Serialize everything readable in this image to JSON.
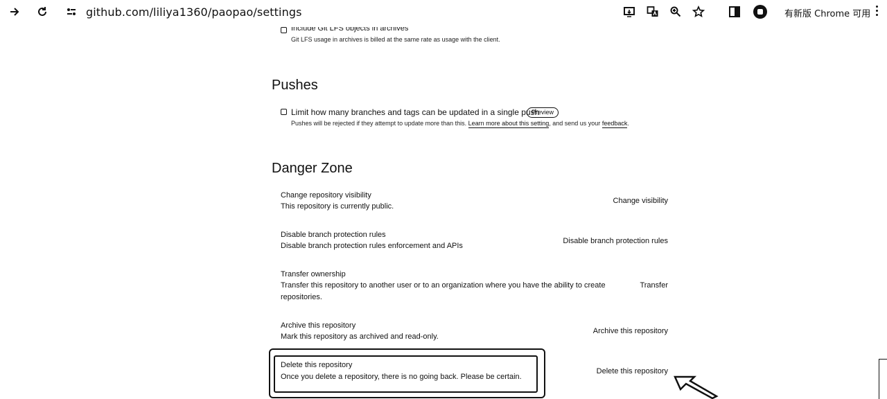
{
  "browser": {
    "url": "github.com/liliya1360/paopao/settings",
    "update_label": "有新版 Chrome 可用",
    "icons": [
      "forward-icon",
      "reload-icon",
      "site-settings-icon",
      "install-app-icon",
      "translate-icon",
      "zoom-icon",
      "bookmark-star-icon",
      "side-panel-icon",
      "extension-icon",
      "more-menu-icon"
    ]
  },
  "archives": {
    "lfs_label": "Include Git LFS objects in archives",
    "lfs_note": "Git LFS usage in archives is billed at the same rate as usage with the client."
  },
  "pushes": {
    "heading": "Pushes",
    "limit_label": "Limit how many branches and tags can be updated in a single push",
    "preview_badge": "Preview",
    "note_prefix": "Pushes will be rejected if they attempt to update more than this.",
    "learn_more_link": "Learn more about this setting",
    "note_middle": ", and send us your",
    "feedback_link": "feedback",
    "note_suffix": "."
  },
  "danger_zone": {
    "heading": "Danger Zone",
    "items": [
      {
        "title": "Change repository visibility",
        "description": "This repository is currently public.",
        "action": "Change visibility"
      },
      {
        "title": "Disable branch protection rules",
        "description": "Disable branch protection rules enforcement and APIs",
        "action": "Disable branch protection rules"
      },
      {
        "title": "Transfer ownership",
        "description_line1": "Transfer this repository to another user or to an organization where you have the ability to create",
        "description_line2": "repositories.",
        "action": "Transfer"
      },
      {
        "title": "Archive this repository",
        "description": "Mark this repository as archived and read-only.",
        "action": "Archive this repository"
      },
      {
        "title": "Delete this repository",
        "description": "Once you delete a repository, there is no going back. Please be certain.",
        "action": "Delete this repository"
      }
    ]
  }
}
